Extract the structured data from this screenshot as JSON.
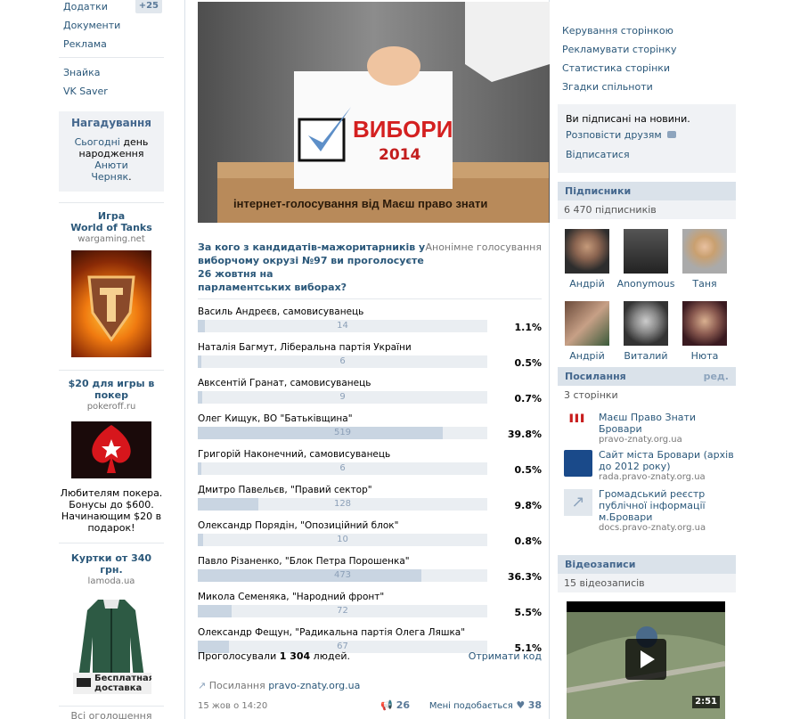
{
  "left": {
    "menu_top": [
      {
        "label": "Додатки",
        "count": "+25"
      },
      {
        "label": "Документи"
      },
      {
        "label": "Реклама"
      }
    ],
    "menu_bottom": [
      {
        "label": "Знайка"
      },
      {
        "label": "VK Saver"
      }
    ],
    "reminder": {
      "title": "Нагадування",
      "line1_link": "Сьогодні",
      "line1_text": "день",
      "line2_text": "народження",
      "line2_link": "Анюти",
      "line3_link": "Черняк",
      "line3_end": "."
    },
    "ads": [
      {
        "title_l1": "Игра",
        "title_l2": "World of Tanks",
        "domain": "wargaming.net"
      },
      {
        "title_l1": "$20 для игры в",
        "title_l2": "покер",
        "domain": "pokeroff.ru",
        "text_l1": "Любителям покера.",
        "text_l2": "Бонусы до $600.",
        "text_l3": "Начинающим $20 в",
        "text_l4": "подарок!"
      },
      {
        "title": "Куртки от 340 грн.",
        "domain": "lamoda.ua",
        "badge_l1": "Бесплатная",
        "badge_l2": "доставка"
      }
    ],
    "all_ads": "Всі оголошення"
  },
  "banner": {
    "title": "ВИБОРИ",
    "year": "2014",
    "caption": "інтернет-голосування від Маєш право знати"
  },
  "poll": {
    "question_l1": "За кого з кандидатів-мажоритарників у",
    "question_l2": "виборчому окрузі №97 ви проголосуєте 26 жовтня на",
    "question_l3": "парламентських виборах?",
    "type": "Анонімне голосування",
    "options": [
      {
        "name": "Василь Андреєв, самовисуванець",
        "votes": "14",
        "percent": "1.1%",
        "share": 0.011
      },
      {
        "name": "Наталія Багмут, Ліберальна партія України",
        "votes": "6",
        "percent": "0.5%",
        "share": 0.005
      },
      {
        "name": "Авксентій Гранат, самовисуванець",
        "votes": "9",
        "percent": "0.7%",
        "share": 0.007
      },
      {
        "name": "Олег Кищук, ВО \"Батьківщина\"",
        "votes": "519",
        "percent": "39.8%",
        "share": 0.398
      },
      {
        "name": "Григорій Наконечний, самовисуванець",
        "votes": "6",
        "percent": "0.5%",
        "share": 0.005
      },
      {
        "name": "Дмитро Павельєв, \"Правий сектор\"",
        "votes": "128",
        "percent": "9.8%",
        "share": 0.098
      },
      {
        "name": "Олександр Порядін, \"Опозиційний блок\"",
        "votes": "10",
        "percent": "0.8%",
        "share": 0.008
      },
      {
        "name": "Павло Різаненко, \"Блок Петра Порошенка\"",
        "votes": "473",
        "percent": "36.3%",
        "share": 0.363
      },
      {
        "name": "Микола Семеняка, \"Народний фронт\"",
        "votes": "72",
        "percent": "5.5%",
        "share": 0.055
      },
      {
        "name": "Олександр Фещун, \"Радикальна партія Олега Ляшка\"",
        "votes": "67",
        "percent": "5.1%",
        "share": 0.051
      }
    ],
    "voted_prefix": "Проголосували",
    "voted_count": "1 304",
    "voted_suffix": "людей.",
    "get_code": "Отримати код"
  },
  "post": {
    "link_label": "Посилання",
    "link_domain": "pravo-znaty.org.ua",
    "date": "15 жов о 14:20",
    "shares": "26",
    "likes_label": "Мені подобається",
    "likes": "38"
  },
  "right": {
    "manage": [
      {
        "label": "Керування сторінкою"
      },
      {
        "label": "Рекламувати сторінку"
      },
      {
        "label": "Статистика сторінки"
      },
      {
        "label": "Згадки спільноти"
      }
    ],
    "subscribed": "Ви підписані на новини.",
    "tell_friends": "Розповісти друзям",
    "unsubscribe": "Відписатися",
    "subscribers_header": "Підписники",
    "subscribers_count": "6 470 підписників",
    "subscribers": [
      {
        "name": "Андрій"
      },
      {
        "name": "Anonymous"
      },
      {
        "name": "Таня"
      },
      {
        "name": "Андрій"
      },
      {
        "name": "Виталий"
      },
      {
        "name": "Нюта"
      }
    ],
    "links_header": "Посилання",
    "links_edit": "ред.",
    "links_count": "3 сторінки",
    "links": [
      {
        "title_l1": "Маєш Право Знати",
        "title_l2": "Бровари",
        "domain": "pravo-znaty.org.ua"
      },
      {
        "title_l1": "Сайт міста Бровари (архів",
        "title_l2": "до 2012 року)",
        "domain": "rada.pravo-znaty.org.ua"
      },
      {
        "title_l1": "Громадський реєстр",
        "title_l2": "публічної інформації",
        "title_l3": "м.Бровари",
        "domain": "docs.pravo-znaty.org.ua"
      }
    ],
    "videos_header": "Відеозаписи",
    "videos_count": "15 відеозаписів",
    "video_duration": "2:51"
  }
}
